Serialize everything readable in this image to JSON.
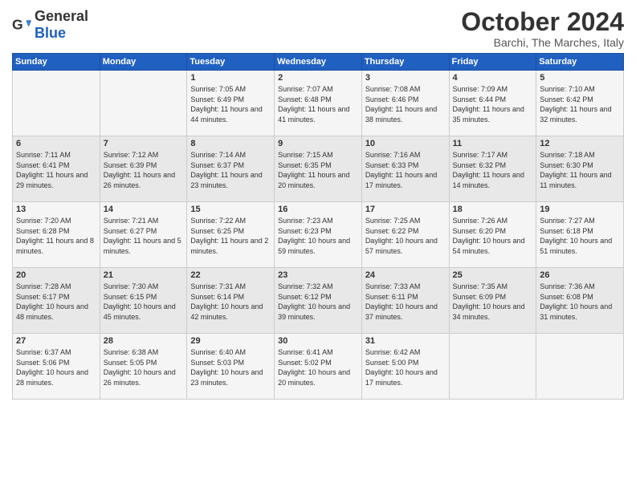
{
  "header": {
    "logo_general": "General",
    "logo_blue": "Blue",
    "month": "October 2024",
    "location": "Barchi, The Marches, Italy"
  },
  "days_of_week": [
    "Sunday",
    "Monday",
    "Tuesday",
    "Wednesday",
    "Thursday",
    "Friday",
    "Saturday"
  ],
  "weeks": [
    [
      {
        "day": "",
        "info": ""
      },
      {
        "day": "",
        "info": ""
      },
      {
        "day": "1",
        "info": "Sunrise: 7:05 AM\nSunset: 6:49 PM\nDaylight: 11 hours\nand 44 minutes."
      },
      {
        "day": "2",
        "info": "Sunrise: 7:07 AM\nSunset: 6:48 PM\nDaylight: 11 hours\nand 41 minutes."
      },
      {
        "day": "3",
        "info": "Sunrise: 7:08 AM\nSunset: 6:46 PM\nDaylight: 11 hours\nand 38 minutes."
      },
      {
        "day": "4",
        "info": "Sunrise: 7:09 AM\nSunset: 6:44 PM\nDaylight: 11 hours\nand 35 minutes."
      },
      {
        "day": "5",
        "info": "Sunrise: 7:10 AM\nSunset: 6:42 PM\nDaylight: 11 hours\nand 32 minutes."
      }
    ],
    [
      {
        "day": "6",
        "info": "Sunrise: 7:11 AM\nSunset: 6:41 PM\nDaylight: 11 hours\nand 29 minutes."
      },
      {
        "day": "7",
        "info": "Sunrise: 7:12 AM\nSunset: 6:39 PM\nDaylight: 11 hours\nand 26 minutes."
      },
      {
        "day": "8",
        "info": "Sunrise: 7:14 AM\nSunset: 6:37 PM\nDaylight: 11 hours\nand 23 minutes."
      },
      {
        "day": "9",
        "info": "Sunrise: 7:15 AM\nSunset: 6:35 PM\nDaylight: 11 hours\nand 20 minutes."
      },
      {
        "day": "10",
        "info": "Sunrise: 7:16 AM\nSunset: 6:33 PM\nDaylight: 11 hours\nand 17 minutes."
      },
      {
        "day": "11",
        "info": "Sunrise: 7:17 AM\nSunset: 6:32 PM\nDaylight: 11 hours\nand 14 minutes."
      },
      {
        "day": "12",
        "info": "Sunrise: 7:18 AM\nSunset: 6:30 PM\nDaylight: 11 hours\nand 11 minutes."
      }
    ],
    [
      {
        "day": "13",
        "info": "Sunrise: 7:20 AM\nSunset: 6:28 PM\nDaylight: 11 hours\nand 8 minutes."
      },
      {
        "day": "14",
        "info": "Sunrise: 7:21 AM\nSunset: 6:27 PM\nDaylight: 11 hours\nand 5 minutes."
      },
      {
        "day": "15",
        "info": "Sunrise: 7:22 AM\nSunset: 6:25 PM\nDaylight: 11 hours\nand 2 minutes."
      },
      {
        "day": "16",
        "info": "Sunrise: 7:23 AM\nSunset: 6:23 PM\nDaylight: 10 hours\nand 59 minutes."
      },
      {
        "day": "17",
        "info": "Sunrise: 7:25 AM\nSunset: 6:22 PM\nDaylight: 10 hours\nand 57 minutes."
      },
      {
        "day": "18",
        "info": "Sunrise: 7:26 AM\nSunset: 6:20 PM\nDaylight: 10 hours\nand 54 minutes."
      },
      {
        "day": "19",
        "info": "Sunrise: 7:27 AM\nSunset: 6:18 PM\nDaylight: 10 hours\nand 51 minutes."
      }
    ],
    [
      {
        "day": "20",
        "info": "Sunrise: 7:28 AM\nSunset: 6:17 PM\nDaylight: 10 hours\nand 48 minutes."
      },
      {
        "day": "21",
        "info": "Sunrise: 7:30 AM\nSunset: 6:15 PM\nDaylight: 10 hours\nand 45 minutes."
      },
      {
        "day": "22",
        "info": "Sunrise: 7:31 AM\nSunset: 6:14 PM\nDaylight: 10 hours\nand 42 minutes."
      },
      {
        "day": "23",
        "info": "Sunrise: 7:32 AM\nSunset: 6:12 PM\nDaylight: 10 hours\nand 39 minutes."
      },
      {
        "day": "24",
        "info": "Sunrise: 7:33 AM\nSunset: 6:11 PM\nDaylight: 10 hours\nand 37 minutes."
      },
      {
        "day": "25",
        "info": "Sunrise: 7:35 AM\nSunset: 6:09 PM\nDaylight: 10 hours\nand 34 minutes."
      },
      {
        "day": "26",
        "info": "Sunrise: 7:36 AM\nSunset: 6:08 PM\nDaylight: 10 hours\nand 31 minutes."
      }
    ],
    [
      {
        "day": "27",
        "info": "Sunrise: 6:37 AM\nSunset: 5:06 PM\nDaylight: 10 hours\nand 28 minutes."
      },
      {
        "day": "28",
        "info": "Sunrise: 6:38 AM\nSunset: 5:05 PM\nDaylight: 10 hours\nand 26 minutes."
      },
      {
        "day": "29",
        "info": "Sunrise: 6:40 AM\nSunset: 5:03 PM\nDaylight: 10 hours\nand 23 minutes."
      },
      {
        "day": "30",
        "info": "Sunrise: 6:41 AM\nSunset: 5:02 PM\nDaylight: 10 hours\nand 20 minutes."
      },
      {
        "day": "31",
        "info": "Sunrise: 6:42 AM\nSunset: 5:00 PM\nDaylight: 10 hours\nand 17 minutes."
      },
      {
        "day": "",
        "info": ""
      },
      {
        "day": "",
        "info": ""
      }
    ]
  ]
}
